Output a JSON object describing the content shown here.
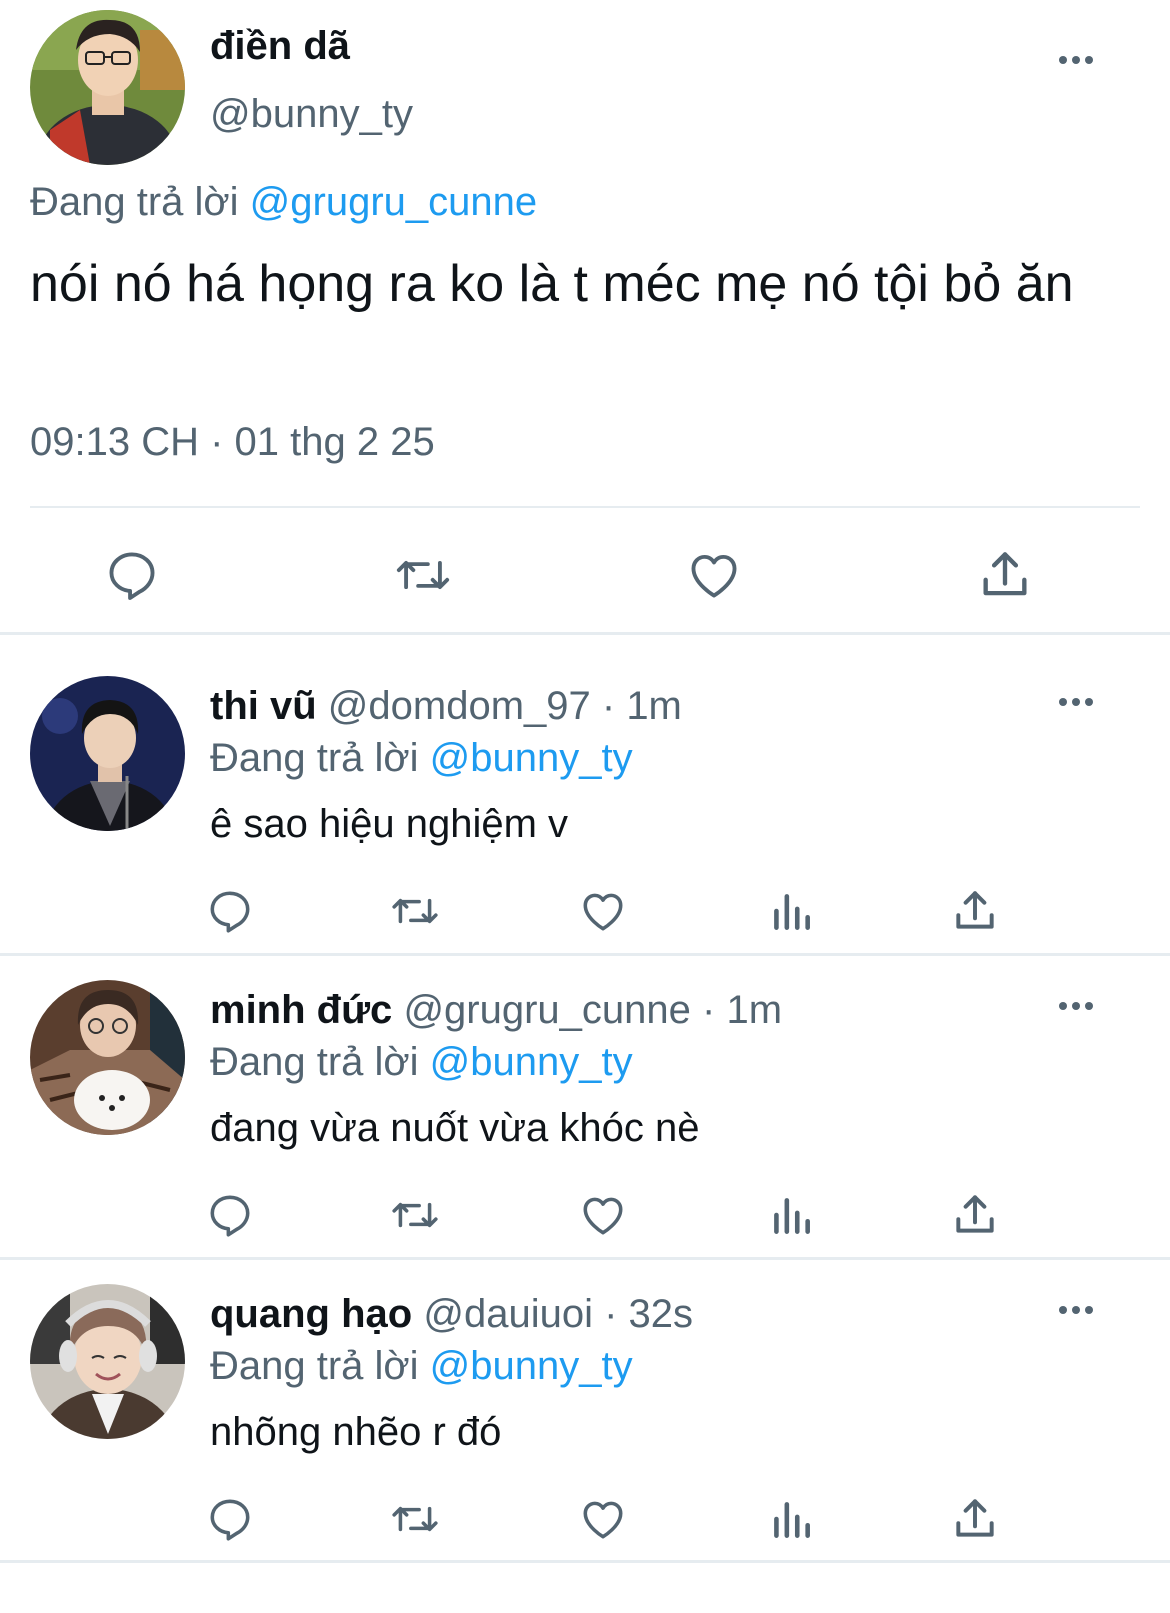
{
  "main_tweet": {
    "author_name": "điền dã",
    "author_handle": "@bunny_ty",
    "replying_prefix": "Đang trả lời",
    "replying_to": "@grugru_cunne",
    "text": "nói nó há họng ra ko là t méc mẹ nó tội bỏ ăn",
    "timestamp": "09:13 CH · 01 thg 2 25"
  },
  "actions": {
    "reply_icon": "reply-icon",
    "retweet_icon": "retweet-icon",
    "like_icon": "like-icon",
    "views_icon": "views-icon",
    "share_icon": "share-icon"
  },
  "replies": [
    {
      "name": "thi vũ",
      "handle": "@domdom_97",
      "separator": " · ",
      "time": "1m",
      "replying_prefix": "Đang trả lời",
      "replying_to": "@bunny_ty",
      "text": "ê sao hiệu nghiệm v"
    },
    {
      "name": "minh đức",
      "handle": "@grugru_cunne",
      "separator": " · ",
      "time": "1m",
      "replying_prefix": "Đang trả lời",
      "replying_to": "@bunny_ty",
      "text": "đang vừa nuốt vừa khóc nè"
    },
    {
      "name": "quang hạo",
      "handle": "@dauiuoi",
      "separator": " · ",
      "time": "32s",
      "replying_prefix": "Đang trả lời",
      "replying_to": "@bunny_ty",
      "text": "nhõng nhẽo r đó"
    }
  ],
  "colors": {
    "text_primary": "#0f1419",
    "text_secondary": "#536471",
    "link": "#1d9bf0",
    "divider": "#e6ecf0"
  }
}
